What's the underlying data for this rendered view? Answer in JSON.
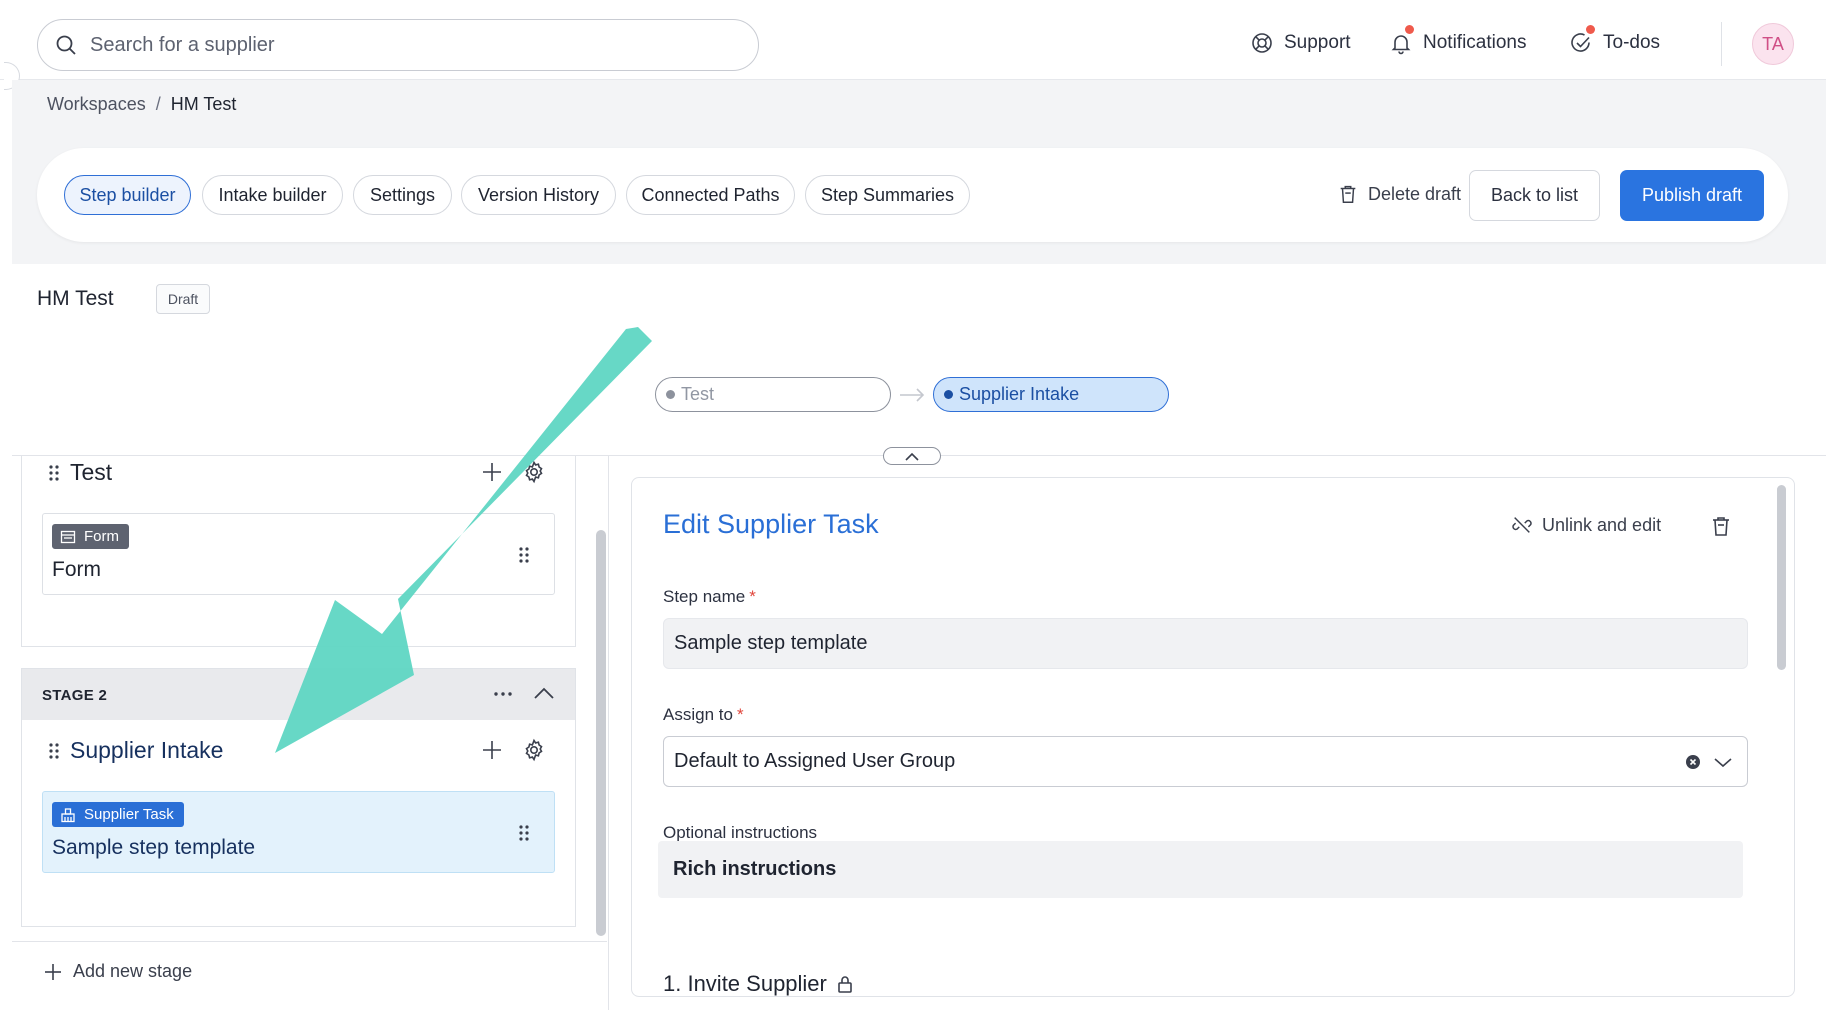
{
  "topbar": {
    "search_placeholder": "Search for a supplier",
    "support_label": "Support",
    "notifications_label": "Notifications",
    "todos_label": "To-dos",
    "avatar_initials": "TA"
  },
  "breadcrumb": {
    "root": "Workspaces",
    "separator": "/",
    "current": "HM Test"
  },
  "toolbar": {
    "tabs": [
      {
        "label": "Step builder",
        "active": true
      },
      {
        "label": "Intake builder",
        "active": false
      },
      {
        "label": "Settings",
        "active": false
      },
      {
        "label": "Version History",
        "active": false
      },
      {
        "label": "Connected Paths",
        "active": false
      },
      {
        "label": "Step Summaries",
        "active": false
      }
    ],
    "delete_label": "Delete draft",
    "back_label": "Back to list",
    "publish_label": "Publish draft"
  },
  "page": {
    "title": "HM Test",
    "status": "Draft"
  },
  "flow": {
    "steps": [
      "Test",
      "Supplier Intake"
    ],
    "active_step": "Supplier Intake"
  },
  "stages": [
    {
      "label": "",
      "step_name": "Test",
      "card": {
        "badge": "Form",
        "title": "Form"
      }
    },
    {
      "label": "STAGE 2",
      "step_name": "Supplier Intake",
      "card": {
        "badge": "Supplier Task",
        "title": "Sample step template"
      }
    }
  ],
  "add_stage_label": "Add new stage",
  "edit_panel": {
    "title": "Edit Supplier Task",
    "unlink_label": "Unlink and edit",
    "step_name_label": "Step name",
    "step_name_value": "Sample step template",
    "assign_label": "Assign to",
    "assign_value": "Default to Assigned User Group",
    "instructions_label": "Optional instructions",
    "instructions_value": "Rich instructions",
    "section_heading": "1. Invite Supplier",
    "required_marker": "*"
  },
  "colors": {
    "accent": "#2a74e0",
    "annotation_arrow": "#5fd6c3",
    "notification_dot": "#ef5a4c"
  }
}
